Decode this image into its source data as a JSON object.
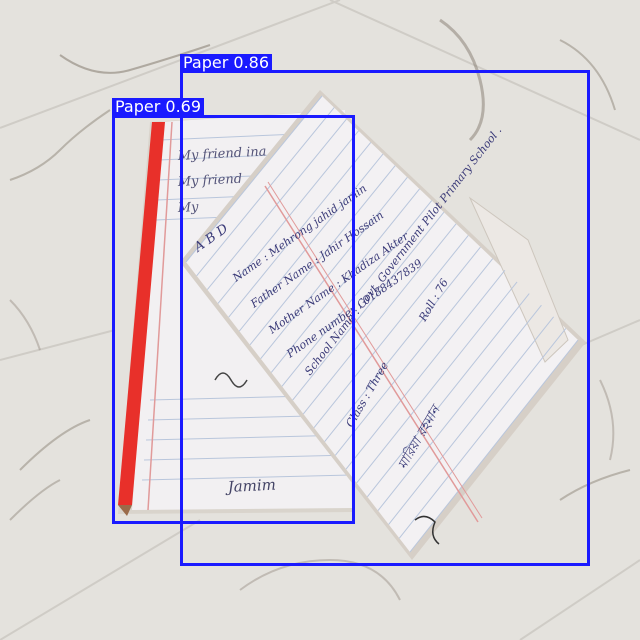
{
  "detections": [
    {
      "label": "Paper",
      "confidence": "0.86",
      "color": "#1a1aff"
    },
    {
      "label": "Paper",
      "confidence": "0.69",
      "color": "#1a1aff"
    }
  ],
  "notebook_text": {
    "heading": "A B D",
    "lines": [
      "Name : Mehrong jahid jamin",
      "Father Name : Jahir Hossain",
      "Mother Name : Khadiza Akter",
      "Phone number : 0188437839",
      "School Name : Govt. Government Pilot Primary School .",
      "Class : Three",
      "Roll : 76"
    ],
    "back_page_lines": [
      "My friend ina",
      "My friend",
      "My"
    ],
    "signature": "Jamim",
    "bengali_text": "মারিয়া রহমান"
  },
  "colors": {
    "floor": "#e4e2dd",
    "paper": "#f3f1f3",
    "ruled_line": "#b9c6dc",
    "margin_line": "#e19a9a",
    "pencil": "#e8302a",
    "ink": "#3a3a78"
  }
}
